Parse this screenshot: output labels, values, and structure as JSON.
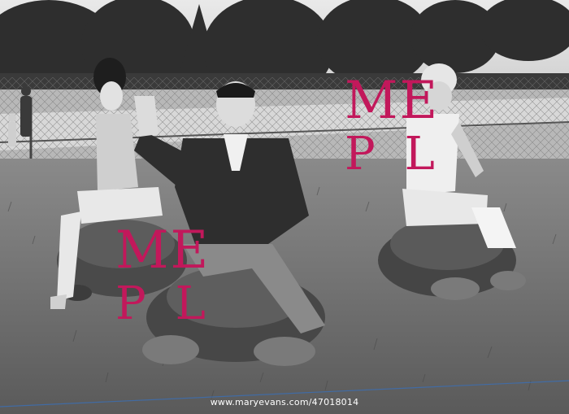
{
  "photo": {
    "scene": "black-and-white photograph",
    "watermark_top": "ME",
    "watermark_bottom": "PL",
    "credit": "www.maryevans.com/47018014"
  }
}
